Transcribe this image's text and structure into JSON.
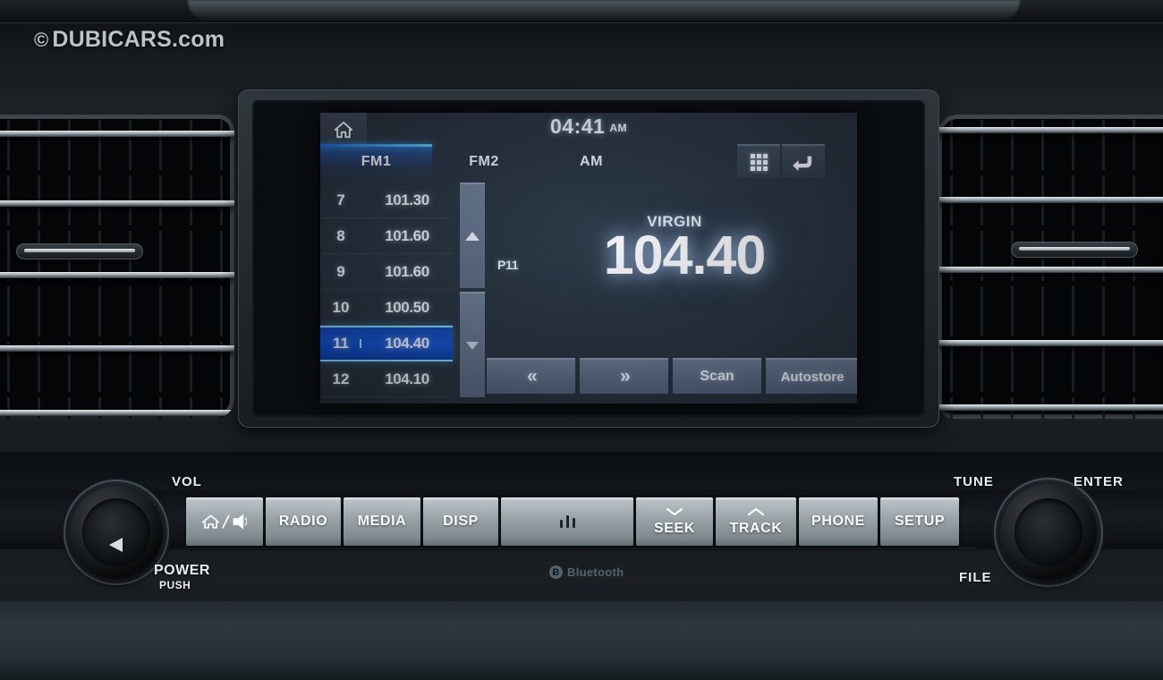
{
  "watermark": {
    "symbol": "©",
    "text": "DUBICARS.com"
  },
  "screen": {
    "clock": {
      "time": "04:41",
      "ampm": "AM"
    },
    "home_icon": "home-icon",
    "top_right_icons": [
      {
        "name": "apps-grid-icon",
        "label": ""
      },
      {
        "name": "back-arrow-icon",
        "glyph": "↩"
      }
    ],
    "bands": [
      {
        "label": "FM1",
        "selected": true
      },
      {
        "label": "FM2",
        "selected": false
      },
      {
        "label": "AM",
        "selected": false
      }
    ],
    "presets": [
      {
        "number": "7",
        "freq": "101.30",
        "selected": false
      },
      {
        "number": "8",
        "freq": "101.60",
        "selected": false
      },
      {
        "number": "9",
        "freq": "101.60",
        "selected": false
      },
      {
        "number": "10",
        "freq": "100.50",
        "selected": false
      },
      {
        "number": "11",
        "freq": "104.40",
        "selected": true
      },
      {
        "number": "12",
        "freq": "104.10",
        "selected": false
      }
    ],
    "scroll": {
      "up": "scroll-up",
      "down": "scroll-down"
    },
    "now_playing": {
      "station_name": "VIRGIN",
      "preset_tag": "P11",
      "frequency": "104.40"
    },
    "actions": [
      {
        "label": "«",
        "name": "seek-down-button"
      },
      {
        "label": "»",
        "name": "seek-up-button"
      },
      {
        "label": "Scan",
        "name": "scan-button"
      },
      {
        "label": "Autostore",
        "name": "autostore-button"
      }
    ],
    "accent_color": "#1a66d8",
    "selected_row_color": "#0f52cf",
    "background_color": "#252f3b"
  },
  "controls": {
    "vol_knob": {
      "label": "VOL",
      "power": "POWER",
      "push": "PUSH"
    },
    "tune_knob": {
      "label": "TUNE",
      "enter": "ENTER",
      "file": "FILE"
    },
    "buttons": [
      {
        "label": "",
        "name": "home-sound-button",
        "icon": "home-sound-icon"
      },
      {
        "label": "RADIO",
        "name": "radio-button"
      },
      {
        "label": "MEDIA",
        "name": "media-button"
      },
      {
        "label": "DISP",
        "name": "disp-button"
      },
      {
        "label": "",
        "name": "eject-button",
        "icon": "cd-slot-icon"
      },
      {
        "label": "SEEK",
        "name": "seek-button"
      },
      {
        "label": "TRACK",
        "name": "track-button"
      },
      {
        "label": "PHONE",
        "name": "phone-button"
      },
      {
        "label": "SETUP",
        "name": "setup-button"
      }
    ],
    "bluetooth": {
      "label": "Bluetooth",
      "glyph": "Ƀ"
    }
  }
}
